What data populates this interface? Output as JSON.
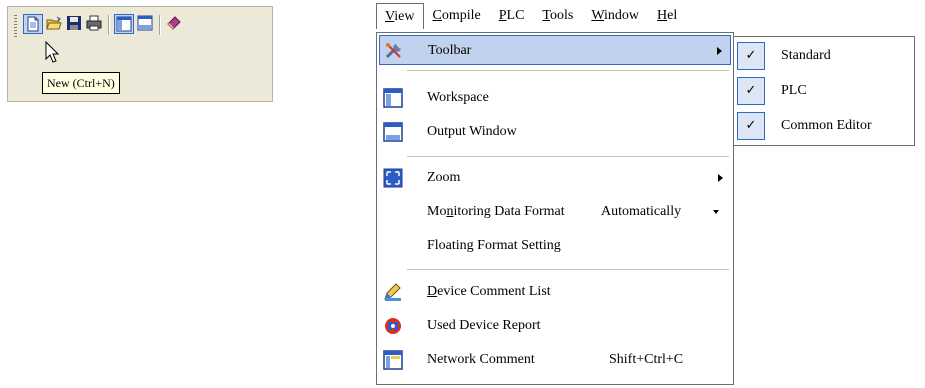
{
  "toolbar": {
    "tooltip": "New (Ctrl+N)",
    "buttons": [
      "new-file-icon",
      "open-folder-icon",
      "save-icon",
      "print-icon",
      "workspace-icon",
      "output-window-icon",
      "book-icon"
    ]
  },
  "menubar": {
    "items": [
      {
        "label_pre": "",
        "label_ul": "V",
        "label_post": "iew"
      },
      {
        "label_pre": "",
        "label_ul": "C",
        "label_post": "ompile"
      },
      {
        "label_pre": "",
        "label_ul": "P",
        "label_post": "LC"
      },
      {
        "label_pre": "",
        "label_ul": "T",
        "label_post": "ools"
      },
      {
        "label_pre": "",
        "label_ul": "W",
        "label_post": "indow"
      },
      {
        "label_pre": "",
        "label_ul": "H",
        "label_post": "el"
      }
    ]
  },
  "view_menu": {
    "toolbar": "Toolbar",
    "workspace": "Workspace",
    "output_window": "Output Window",
    "zoom": "Zoom",
    "monitoring_pre": "Mo",
    "monitoring_ul": "n",
    "monitoring_post": "itoring Data Format",
    "monitoring_value": "Automatically",
    "floating_format": "Floating Format Setting",
    "device_comment_ul": "D",
    "device_comment_post": "evice Comment List",
    "used_device_report": "Used Device Report",
    "network_comment": "Network Comment",
    "network_comment_shortcut": "Shift+Ctrl+C"
  },
  "toolbar_submenu": {
    "items": [
      "Standard",
      "PLC",
      "Common Editor"
    ],
    "check": "✓"
  }
}
